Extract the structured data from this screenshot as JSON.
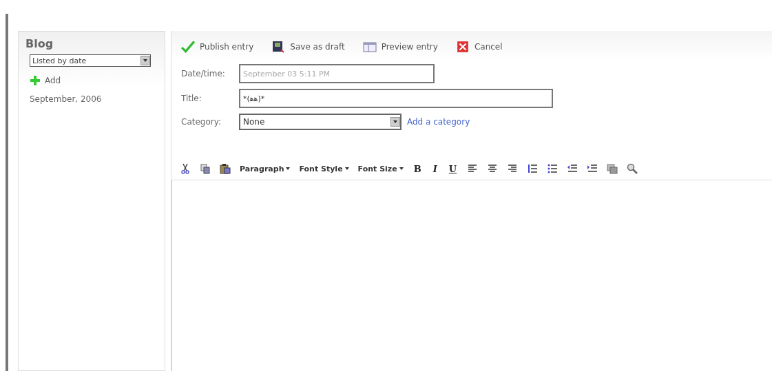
{
  "sidebar": {
    "title": "Blog",
    "sort_select": {
      "value": "Listed by date"
    },
    "add_link": "Add",
    "archives": [
      "September, 2006"
    ]
  },
  "actions": [
    {
      "kind": "publish",
      "label": "Publish entry"
    },
    {
      "kind": "draft",
      "label": "Save as draft"
    },
    {
      "kind": "preview",
      "label": "Preview entry"
    },
    {
      "kind": "cancel",
      "label": "Cancel"
    }
  ],
  "form": {
    "datetime_label": "Date/time:",
    "datetime_value": "September 03 5:11 PM",
    "title_label": "Title:",
    "title_value": "*(ﻫﻫ)*",
    "category_label": "Category:",
    "category_value": "None",
    "add_category": "Add a category"
  },
  "editor_toolbar": [
    {
      "kind": "cut"
    },
    {
      "kind": "copy"
    },
    {
      "kind": "paste"
    },
    {
      "kind": "dropdown",
      "label": "Paragraph"
    },
    {
      "kind": "dropdown",
      "label": "Font Style"
    },
    {
      "kind": "dropdown",
      "label": "Font Size"
    },
    {
      "kind": "bold",
      "label": "B"
    },
    {
      "kind": "italic",
      "label": "I"
    },
    {
      "kind": "underline",
      "label": "U"
    },
    {
      "kind": "align-left"
    },
    {
      "kind": "align-center"
    },
    {
      "kind": "align-right"
    },
    {
      "kind": "ordered-list"
    },
    {
      "kind": "bullet-list"
    },
    {
      "kind": "outdent"
    },
    {
      "kind": "indent"
    },
    {
      "kind": "image"
    },
    {
      "kind": "search"
    }
  ]
}
